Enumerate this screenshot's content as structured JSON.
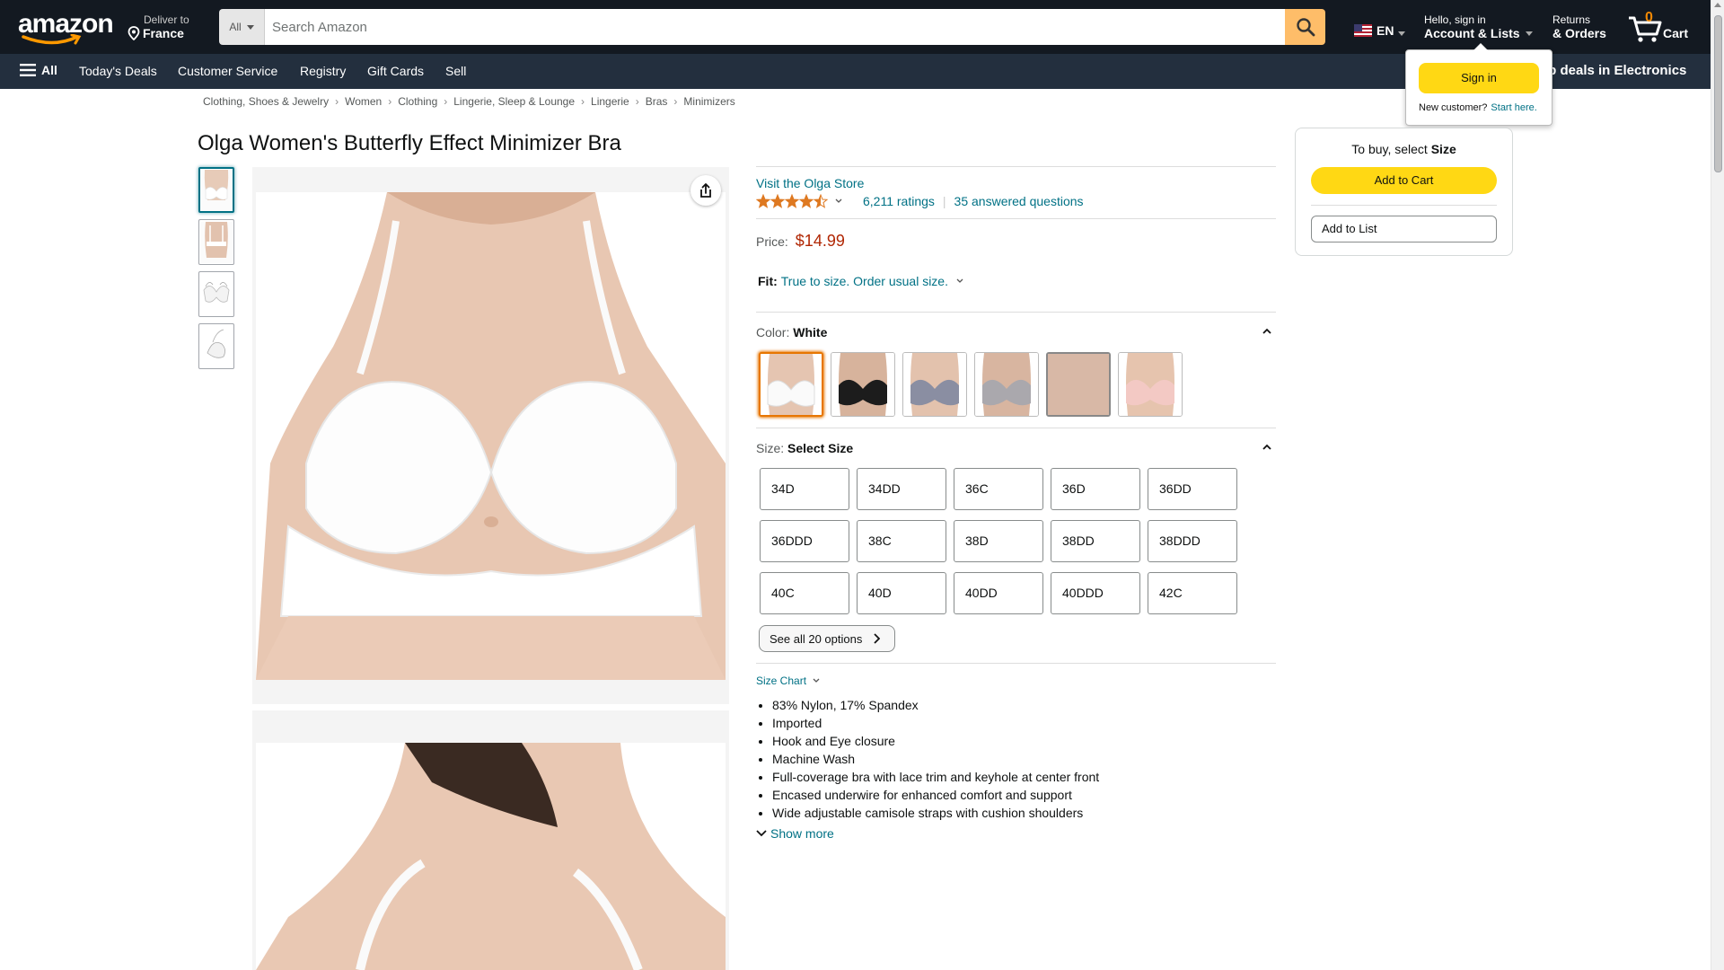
{
  "header": {
    "logo_text": "amazon",
    "deliver_line1": "Deliver to",
    "deliver_line2": "France",
    "search_category": "All",
    "search_placeholder": "Search Amazon",
    "language": "EN",
    "account_line1": "Hello, sign in",
    "account_line2": "Account & Lists",
    "returns_line1": "Returns",
    "returns_line2": "& Orders",
    "cart_count": "0",
    "cart_label": "Cart"
  },
  "subnav": {
    "all_label": "All",
    "links": [
      "Today's Deals",
      "Customer Service",
      "Registry",
      "Gift Cards",
      "Sell"
    ],
    "promo": "op deals in Electronics"
  },
  "signin_flyout": {
    "button": "Sign in",
    "new_customer": "New customer?",
    "start_here": "Start here."
  },
  "breadcrumb": [
    "Clothing, Shoes & Jewelry",
    "Women",
    "Clothing",
    "Lingerie, Sleep & Lounge",
    "Lingerie",
    "Bras",
    "Minimizers"
  ],
  "product": {
    "title": "Olga Women's Butterfly Effect Minimizer Bra",
    "store_link": "Visit the Olga Store",
    "stars": 4.5,
    "ratings": "6,211 ratings",
    "answered": "35 answered questions",
    "price_label": "Price:",
    "price": "$14.99",
    "fit_label": "Fit:",
    "fit_value": "True to size. Order usual size.",
    "color_label": "Color:",
    "color_value": "White",
    "size_label": "Size:",
    "size_value": "Select Size",
    "sizes": [
      "34D",
      "34DD",
      "36C",
      "36D",
      "36DD",
      "36DDD",
      "38C",
      "38D",
      "38DD",
      "38DDD",
      "40C",
      "40D",
      "40DD",
      "40DDD",
      "42C"
    ],
    "see_all": "See all 20 options",
    "size_chart": "Size Chart",
    "bullets": [
      "83% Nylon, 17% Spandex",
      "Imported",
      "Hook and Eye closure",
      "Machine Wash",
      "Full-coverage bra with lace trim and keyhole at center front",
      "Encased underwire for enhanced comfort and support",
      "Wide adjustable camisole straps with cushion shoulders"
    ],
    "show_more": "Show more"
  },
  "buybox": {
    "prompt_prefix": "To buy, select",
    "prompt_bold": "Size",
    "add_to_cart": "Add to Cart",
    "add_to_list": "Add to List"
  },
  "colors": {
    "nav_dark": "#131921",
    "nav_sub": "#232f3e",
    "link": "#007185",
    "price": "#b12704",
    "button_yellow": "#ffd814",
    "search_button": "#febd69",
    "selected_orange": "#e77600"
  },
  "swatches": [
    {
      "name": "white",
      "color": "#f4f4f4",
      "selected": true
    },
    {
      "name": "black",
      "color": "#1c1c1c"
    },
    {
      "name": "gray-blue",
      "color": "#8a8ea2"
    },
    {
      "name": "silver",
      "color": "#aaa8ad"
    },
    {
      "name": "nude",
      "color": "#d8b8a6"
    },
    {
      "name": "pink",
      "color": "#f3c9c4"
    }
  ]
}
